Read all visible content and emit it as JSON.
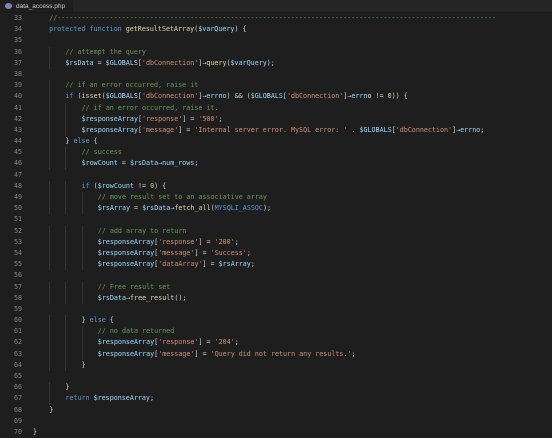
{
  "tab": {
    "filename": "data_access.php",
    "icon": "php-file-icon"
  },
  "colors": {
    "background": "#1e1e1e",
    "keyword": "#569cd6",
    "function": "#dcdcaa",
    "variable": "#9cdcfe",
    "string": "#ce9178",
    "number": "#b5cea8",
    "comment": "#6a9955",
    "line_number": "#858585"
  },
  "lines": [
    {
      "n": "33",
      "indent": 1,
      "t": [
        [
          "cm",
          "//-------------------------------------------------------------------------------------------------------------"
        ]
      ]
    },
    {
      "n": "34",
      "indent": 1,
      "t": [
        [
          "kw",
          "protected"
        ],
        [
          "op",
          " "
        ],
        [
          "kw",
          "function"
        ],
        [
          "op",
          " "
        ],
        [
          "fn",
          "getResultSetArray"
        ],
        [
          "op",
          "("
        ],
        [
          "var",
          "$varQuery"
        ],
        [
          "op",
          ") {"
        ]
      ]
    },
    {
      "n": "35",
      "indent": 0,
      "t": []
    },
    {
      "n": "36",
      "indent": 2,
      "t": [
        [
          "cm",
          "// attempt the query"
        ]
      ]
    },
    {
      "n": "37",
      "indent": 2,
      "t": [
        [
          "var",
          "$rsData"
        ],
        [
          "op",
          " = "
        ],
        [
          "var",
          "$GLOBALS"
        ],
        [
          "op",
          "["
        ],
        [
          "str",
          "'dbConnection'"
        ],
        [
          "op",
          "]→"
        ],
        [
          "fn",
          "query"
        ],
        [
          "op",
          "("
        ],
        [
          "var",
          "$varQuery"
        ],
        [
          "op",
          ");"
        ]
      ]
    },
    {
      "n": "38",
      "indent": 0,
      "t": []
    },
    {
      "n": "39",
      "indent": 2,
      "t": [
        [
          "cm",
          "// if an error occurred, raise it"
        ]
      ]
    },
    {
      "n": "40",
      "indent": 2,
      "t": [
        [
          "kw",
          "if"
        ],
        [
          "op",
          " ("
        ],
        [
          "fn",
          "isset"
        ],
        [
          "op",
          "("
        ],
        [
          "var",
          "$GLOBALS"
        ],
        [
          "op",
          "["
        ],
        [
          "str",
          "'dbConnection'"
        ],
        [
          "op",
          "]→"
        ],
        [
          "var",
          "errno"
        ],
        [
          "op",
          ") && ("
        ],
        [
          "var",
          "$GLOBALS"
        ],
        [
          "op",
          "["
        ],
        [
          "str",
          "'dbConnection'"
        ],
        [
          "op",
          "]→"
        ],
        [
          "var",
          "errno"
        ],
        [
          "op",
          " != "
        ],
        [
          "num",
          "0"
        ],
        [
          "op",
          ")) {"
        ]
      ]
    },
    {
      "n": "41",
      "indent": 3,
      "t": [
        [
          "cm",
          "// if an error occurred, raise it."
        ]
      ]
    },
    {
      "n": "42",
      "indent": 3,
      "t": [
        [
          "var",
          "$responseArray"
        ],
        [
          "op",
          "["
        ],
        [
          "str",
          "'response'"
        ],
        [
          "op",
          "] = "
        ],
        [
          "str",
          "'500'"
        ],
        [
          "op",
          ";"
        ]
      ]
    },
    {
      "n": "43",
      "indent": 3,
      "t": [
        [
          "var",
          "$responseArray"
        ],
        [
          "op",
          "["
        ],
        [
          "str",
          "'message'"
        ],
        [
          "op",
          "] = "
        ],
        [
          "str",
          "'Internal server error. MySQL error: '"
        ],
        [
          "op",
          " . "
        ],
        [
          "var",
          "$GLOBALS"
        ],
        [
          "op",
          "["
        ],
        [
          "str",
          "'dbConnection'"
        ],
        [
          "op",
          "]→"
        ],
        [
          "var",
          "errno"
        ],
        [
          "op",
          ";"
        ]
      ]
    },
    {
      "n": "44",
      "indent": 2,
      "t": [
        [
          "op",
          "} "
        ],
        [
          "kw",
          "else"
        ],
        [
          "op",
          " {"
        ]
      ]
    },
    {
      "n": "45",
      "indent": 3,
      "t": [
        [
          "cm",
          "// success"
        ]
      ]
    },
    {
      "n": "46",
      "indent": 3,
      "t": [
        [
          "var",
          "$rowCount"
        ],
        [
          "op",
          " = "
        ],
        [
          "var",
          "$rsData"
        ],
        [
          "op",
          "→"
        ],
        [
          "var",
          "num_rows"
        ],
        [
          "op",
          ";"
        ]
      ]
    },
    {
      "n": "47",
      "indent": 0,
      "t": []
    },
    {
      "n": "48",
      "indent": 3,
      "t": [
        [
          "kw",
          "if"
        ],
        [
          "op",
          " ("
        ],
        [
          "var",
          "$rowCount"
        ],
        [
          "op",
          " != "
        ],
        [
          "num",
          "0"
        ],
        [
          "op",
          ") {"
        ]
      ]
    },
    {
      "n": "49",
      "indent": 4,
      "t": [
        [
          "cm",
          "// move result set to an associative array"
        ]
      ]
    },
    {
      "n": "50",
      "indent": 4,
      "t": [
        [
          "var",
          "$rsArray"
        ],
        [
          "op",
          " = "
        ],
        [
          "var",
          "$rsData"
        ],
        [
          "op",
          "→"
        ],
        [
          "fn",
          "fetch_all"
        ],
        [
          "op",
          "("
        ],
        [
          "kw",
          "MYSQLI_ASSOC"
        ],
        [
          "op",
          ");"
        ]
      ]
    },
    {
      "n": "51",
      "indent": 0,
      "t": []
    },
    {
      "n": "52",
      "indent": 4,
      "t": [
        [
          "cm",
          "// add array to return"
        ]
      ]
    },
    {
      "n": "53",
      "indent": 4,
      "t": [
        [
          "var",
          "$responseArray"
        ],
        [
          "op",
          "["
        ],
        [
          "str",
          "'response'"
        ],
        [
          "op",
          "] = "
        ],
        [
          "str",
          "'200'"
        ],
        [
          "op",
          ";"
        ]
      ]
    },
    {
      "n": "54",
      "indent": 4,
      "t": [
        [
          "var",
          "$responseArray"
        ],
        [
          "op",
          "["
        ],
        [
          "str",
          "'message'"
        ],
        [
          "op",
          "] = "
        ],
        [
          "str",
          "'Success'"
        ],
        [
          "op",
          ";"
        ]
      ]
    },
    {
      "n": "55",
      "indent": 4,
      "t": [
        [
          "var",
          "$responseArray"
        ],
        [
          "op",
          "["
        ],
        [
          "str",
          "'dataArray'"
        ],
        [
          "op",
          "] = "
        ],
        [
          "var",
          "$rsArray"
        ],
        [
          "op",
          ";"
        ]
      ]
    },
    {
      "n": "56",
      "indent": 0,
      "t": []
    },
    {
      "n": "57",
      "indent": 4,
      "t": [
        [
          "cm",
          "// Free result set"
        ]
      ]
    },
    {
      "n": "58",
      "indent": 4,
      "t": [
        [
          "var",
          "$rsData"
        ],
        [
          "op",
          "→"
        ],
        [
          "fn",
          "free_result"
        ],
        [
          "op",
          "();"
        ]
      ]
    },
    {
      "n": "59",
      "indent": 0,
      "t": []
    },
    {
      "n": "60",
      "indent": 3,
      "t": [
        [
          "op",
          "} "
        ],
        [
          "kw",
          "else"
        ],
        [
          "op",
          " {"
        ]
      ]
    },
    {
      "n": "61",
      "indent": 4,
      "t": [
        [
          "cm",
          "// no data returned"
        ]
      ]
    },
    {
      "n": "62",
      "indent": 4,
      "t": [
        [
          "var",
          "$responseArray"
        ],
        [
          "op",
          "["
        ],
        [
          "str",
          "'response'"
        ],
        [
          "op",
          "] = "
        ],
        [
          "str",
          "'204'"
        ],
        [
          "op",
          ";"
        ]
      ]
    },
    {
      "n": "63",
      "indent": 4,
      "t": [
        [
          "var",
          "$responseArray"
        ],
        [
          "op",
          "["
        ],
        [
          "str",
          "'message'"
        ],
        [
          "op",
          "] = "
        ],
        [
          "str",
          "'Query did not return any results.'"
        ],
        [
          "op",
          ";"
        ]
      ]
    },
    {
      "n": "64",
      "indent": 3,
      "t": [
        [
          "op",
          "}"
        ]
      ]
    },
    {
      "n": "65",
      "indent": 0,
      "t": []
    },
    {
      "n": "66",
      "indent": 2,
      "t": [
        [
          "op",
          "}"
        ]
      ]
    },
    {
      "n": "67",
      "indent": 2,
      "t": [
        [
          "kw",
          "return"
        ],
        [
          "op",
          " "
        ],
        [
          "var",
          "$responseArray"
        ],
        [
          "op",
          ";"
        ]
      ]
    },
    {
      "n": "68",
      "indent": 1,
      "t": [
        [
          "op",
          "}"
        ]
      ]
    },
    {
      "n": "69",
      "indent": 0,
      "t": []
    },
    {
      "n": "70",
      "indent": 0,
      "t": [
        [
          "op",
          "}"
        ]
      ]
    }
  ]
}
